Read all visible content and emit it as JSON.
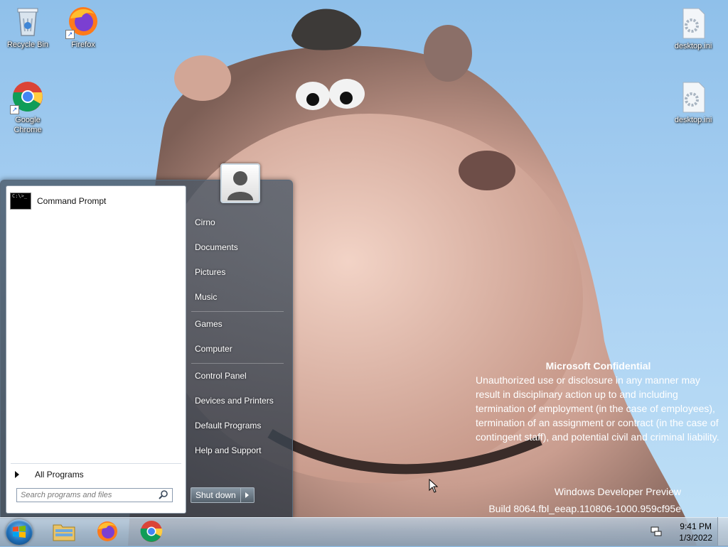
{
  "desktop": {
    "icons": [
      {
        "label": "Recycle Bin",
        "icon": "recycle-bin-icon"
      },
      {
        "label": "Firefox",
        "icon": "firefox-icon"
      },
      {
        "label": "Google Chrome",
        "icon": "chrome-icon"
      },
      {
        "label": "desktop.ini",
        "icon": "settings-file-icon"
      },
      {
        "label": "desktop.ini",
        "icon": "settings-file-icon"
      }
    ],
    "watermark": {
      "title": "Microsoft Confidential",
      "body": "Unauthorized use or disclosure in any manner may result in disciplinary action up to and including termination of employment (in the case of employees), termination of an assignment or contract (in the case of contingent staff), and potential civil and criminal liability.",
      "product": "Windows Developer Preview",
      "build": "Build 8064.fbl_eeap.110806-1000.959cf95e"
    }
  },
  "start_menu": {
    "pinned": [
      {
        "label": "Command Prompt",
        "icon": "command-prompt-icon"
      }
    ],
    "all_programs": "All Programs",
    "search_placeholder": "Search programs and files",
    "user_picture": "user-avatar-icon",
    "right_items": [
      "Cirno",
      "Documents",
      "Pictures",
      "Music",
      "Games",
      "Computer",
      "Control Panel",
      "Devices and Printers",
      "Default Programs",
      "Help and Support"
    ],
    "shutdown_label": "Shut down"
  },
  "taskbar": {
    "start_button": "windows-orb-icon",
    "pinned": [
      "file-explorer-icon",
      "firefox-icon",
      "chrome-icon"
    ],
    "tray_icon": "network-icon",
    "time": "9:41 PM",
    "date": "1/3/2022"
  },
  "colors": {
    "sky": "#a9d0f2",
    "menu_glass": "#46555f",
    "taskbar": "#a0b2c4"
  }
}
